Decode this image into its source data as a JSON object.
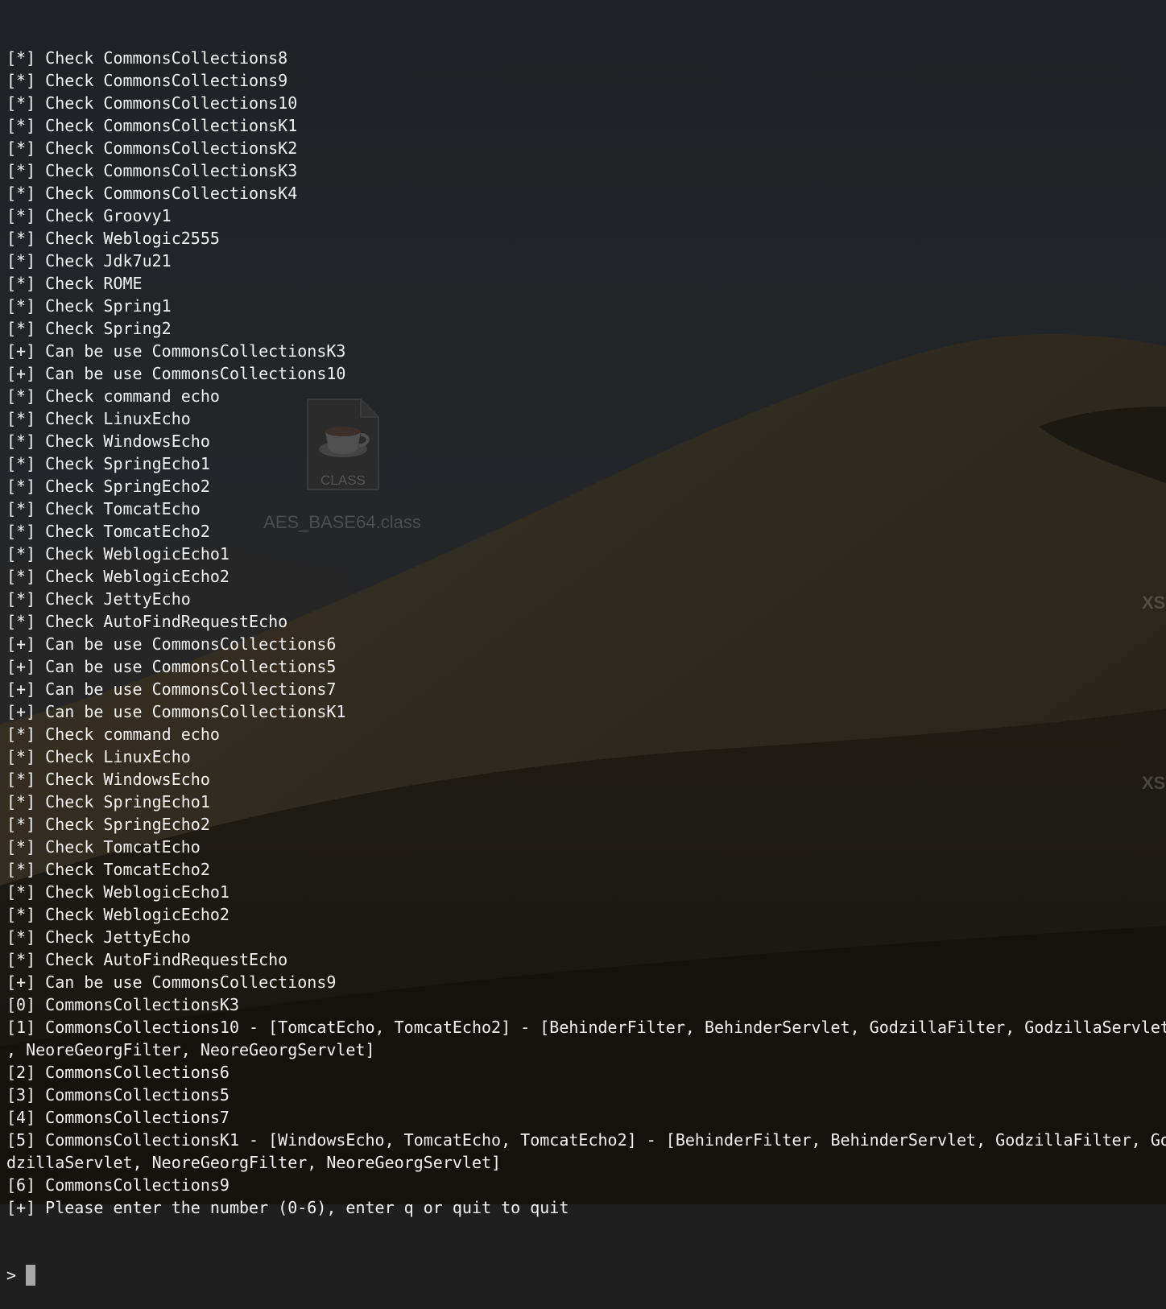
{
  "desktop": {
    "icon_badge": "CLASS",
    "icon_label": "AES_BASE64.class",
    "edge_label_1": "XS",
    "edge_label_2": "XS",
    "colors": {
      "sky": "#1e2226",
      "dune_light": "#3a3224",
      "dune_dark": "#17140f"
    }
  },
  "terminal": {
    "text_color": "#f2f2f2",
    "cursor_color": "#a8a8a8",
    "lines": [
      "[*] Check CommonsCollections8",
      "[*] Check CommonsCollections9",
      "[*] Check CommonsCollections10",
      "[*] Check CommonsCollectionsK1",
      "[*] Check CommonsCollectionsK2",
      "[*] Check CommonsCollectionsK3",
      "[*] Check CommonsCollectionsK4",
      "[*] Check Groovy1",
      "[*] Check Weblogic2555",
      "[*] Check Jdk7u21",
      "[*] Check ROME",
      "[*] Check Spring1",
      "[*] Check Spring2",
      "[+] Can be use CommonsCollectionsK3",
      "[+] Can be use CommonsCollections10",
      "[*] Check command echo",
      "[*] Check LinuxEcho",
      "[*] Check WindowsEcho",
      "[*] Check SpringEcho1",
      "[*] Check SpringEcho2",
      "[*] Check TomcatEcho",
      "[*] Check TomcatEcho2",
      "[*] Check WeblogicEcho1",
      "[*] Check WeblogicEcho2",
      "[*] Check JettyEcho",
      "[*] Check AutoFindRequestEcho",
      "[+] Can be use CommonsCollections6",
      "[+] Can be use CommonsCollections5",
      "[+] Can be use CommonsCollections7",
      "[+] Can be use CommonsCollectionsK1",
      "[*] Check command echo",
      "[*] Check LinuxEcho",
      "[*] Check WindowsEcho",
      "[*] Check SpringEcho1",
      "[*] Check SpringEcho2",
      "[*] Check TomcatEcho",
      "[*] Check TomcatEcho2",
      "[*] Check WeblogicEcho1",
      "[*] Check WeblogicEcho2",
      "[*] Check JettyEcho",
      "[*] Check AutoFindRequestEcho",
      "[+] Can be use CommonsCollections9",
      "[0] CommonsCollectionsK3",
      "[1] CommonsCollections10 - [TomcatEcho, TomcatEcho2] - [BehinderFilter, BehinderServlet, GodzillaFilter, GodzillaServlet",
      ", NeoreGeorgFilter, NeoreGeorgServlet]",
      "[2] CommonsCollections6",
      "[3] CommonsCollections5",
      "[4] CommonsCollections7",
      "[5] CommonsCollectionsK1 - [WindowsEcho, TomcatEcho, TomcatEcho2] - [BehinderFilter, BehinderServlet, GodzillaFilter, Go",
      "dzillaServlet, NeoreGeorgFilter, NeoreGeorgServlet]",
      "[6] CommonsCollections9",
      "[+] Please enter the number (0-6), enter q or quit to quit"
    ],
    "prompt": ">",
    "input_value": ""
  }
}
